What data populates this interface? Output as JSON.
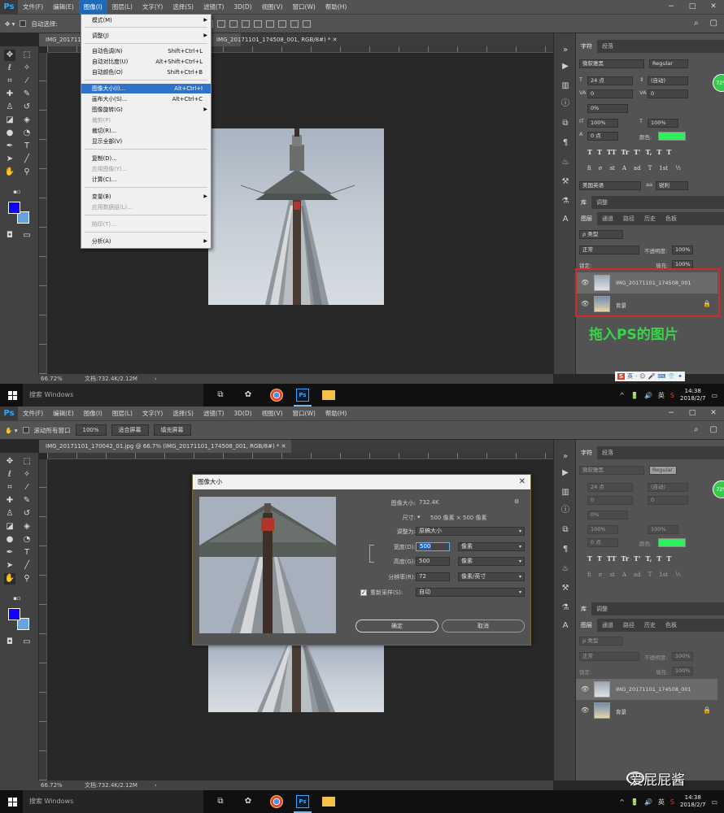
{
  "app": {
    "logo": "Ps",
    "menus": [
      "文件(F)",
      "编辑(E)",
      "图像(I)",
      "图层(L)",
      "文字(Y)",
      "选择(S)",
      "滤镜(T)",
      "3D(D)",
      "视图(V)",
      "窗口(W)",
      "帮助(H)"
    ],
    "window_controls": [
      "−",
      "□",
      "✕"
    ],
    "options_bar_1": {
      "tool_option": "自动选择:"
    },
    "options_bar_2": {
      "scroll_all": "滚动所有窗口",
      "zoom_100": "100%",
      "fit_screen": "适合屏幕",
      "fill_screen": "填充屏幕"
    },
    "tab_1": "IMG_20171101_174508_001, RGB/8#) *",
    "tab_1_prefix": "IMG_2017110",
    "tab_2": "IMG_20171101_170042_01.jpg @ 66.7% (IMG_20171101_174508_001, RGB/8#) *",
    "status": {
      "zoom": "66.72%",
      "doc": "文档:732.4K/2.12M"
    }
  },
  "image_menu": {
    "items": [
      {
        "label": "模式(M)",
        "shortcut": "",
        "arrow": true,
        "disabled": false
      },
      {
        "label": "调整(J)",
        "shortcut": "",
        "arrow": true,
        "disabled": false
      },
      {
        "label": "自动色调(N)",
        "shortcut": "Shift+Ctrl+L",
        "arrow": false,
        "disabled": false
      },
      {
        "label": "自动对比度(U)",
        "shortcut": "Alt+Shift+Ctrl+L",
        "arrow": false,
        "disabled": false
      },
      {
        "label": "自动颜色(O)",
        "shortcut": "Shift+Ctrl+B",
        "arrow": false,
        "disabled": false
      },
      {
        "label": "图像大小(I)...",
        "shortcut": "Alt+Ctrl+I",
        "arrow": false,
        "disabled": false,
        "highlight": true
      },
      {
        "label": "画布大小(S)...",
        "shortcut": "Alt+Ctrl+C",
        "arrow": false,
        "disabled": false
      },
      {
        "label": "图像旋转(G)",
        "shortcut": "",
        "arrow": true,
        "disabled": false
      },
      {
        "label": "裁剪(P)",
        "shortcut": "",
        "arrow": false,
        "disabled": true
      },
      {
        "label": "裁切(R)...",
        "shortcut": "",
        "arrow": false,
        "disabled": false
      },
      {
        "label": "显示全部(V)",
        "shortcut": "",
        "arrow": false,
        "disabled": false
      },
      {
        "label": "复制(D)...",
        "shortcut": "",
        "arrow": false,
        "disabled": false
      },
      {
        "label": "应用图像(Y)...",
        "shortcut": "",
        "arrow": false,
        "disabled": true
      },
      {
        "label": "计算(C)...",
        "shortcut": "",
        "arrow": false,
        "disabled": false
      },
      {
        "label": "变量(B)",
        "shortcut": "",
        "arrow": true,
        "disabled": false
      },
      {
        "label": "应用数据组(L)...",
        "shortcut": "",
        "arrow": false,
        "disabled": true
      },
      {
        "label": "陷印(T)...",
        "shortcut": "",
        "arrow": false,
        "disabled": true
      },
      {
        "label": "分析(A)",
        "shortcut": "",
        "arrow": true,
        "disabled": false
      }
    ]
  },
  "character_panel": {
    "tabs": [
      "字符",
      "段落"
    ],
    "font_family": "微软雅黑",
    "font_style": "Regular",
    "font_size": "24 点",
    "leading": "(自动)",
    "kerning": "0",
    "tracking": "0",
    "scale_pct": "0%",
    "vertical_scale": "100%",
    "horizontal_scale": "100%",
    "baseline": "0 点",
    "color_label": "颜色:",
    "type_styles": [
      "T",
      "T",
      "TT",
      "Tr",
      "T'",
      "T,",
      "T",
      "T"
    ],
    "opentype": [
      "fi",
      "σ",
      "st",
      "A",
      "ad",
      "T",
      "1st",
      "½"
    ],
    "language": "美国英语",
    "antialias": "锐利",
    "badge": "72%"
  },
  "layers_panel": {
    "top_tabs": [
      "库",
      "调整"
    ],
    "tabs": [
      "图层",
      "通道",
      "路径",
      "历史",
      "色板"
    ],
    "filter_kind": "ρ 类型",
    "blend_mode": "正常",
    "opacity_label": "不透明度:",
    "opacity": "100%",
    "lock_label": "锁定:",
    "fill_label": "填充:",
    "fill": "100%",
    "layers": [
      {
        "name": "IMG_20171101_174508_001",
        "selected": true
      },
      {
        "name": "背景",
        "selected": false,
        "locked": true
      }
    ]
  },
  "annotation": "拖入PS的图片",
  "image_size_dialog": {
    "title": "图像大小",
    "close": "✕",
    "image_size_label": "图像大小:",
    "image_size_value": "732.4K",
    "dimensions_label": "尺寸:",
    "dimensions_value": "500 像素 × 500 像素",
    "fit_to_label": "调整为:",
    "fit_to_value": "原稿大小",
    "width_label": "宽度(D):",
    "width_value": "500",
    "width_unit": "像素",
    "height_label": "高度(G):",
    "height_value": "500",
    "height_unit": "像素",
    "resolution_label": "分辨率(R):",
    "resolution_value": "72",
    "resolution_unit": "像素/英寸",
    "resample_label": "重新采样(S):",
    "resample_value": "自动",
    "ok": "确定",
    "cancel": "取消"
  },
  "taskbar": {
    "search": "搜索 Windows",
    "time": "14:38",
    "date": "2018/2/7",
    "ime_lang": "英",
    "tray": [
      "^",
      "🔋",
      "🔊",
      "英",
      "S"
    ]
  },
  "ime_toolbar": {
    "logo": "S",
    "lang": "英",
    "items": [
      "·",
      "☺",
      "🎤",
      "⌨",
      "👕",
      "✦"
    ]
  },
  "watermark": {
    "text": "爱屁屁酱"
  },
  "colors": {
    "ps_blue": "#31a8ff",
    "menu_highlight": "#2f72c9",
    "red_frame": "#d22a2a",
    "annotation_green": "#39d44a",
    "foreground": "#1100ff",
    "background": "#66a3de",
    "text_color_chip": "#2bf25b"
  },
  "icons": [
    "move-icon",
    "marquee-icon",
    "lasso-icon",
    "magic-wand-icon",
    "crop-icon",
    "eyedropper-icon",
    "healing-brush-icon",
    "brush-icon",
    "stamp-icon",
    "history-brush-icon",
    "eraser-icon",
    "bucket-icon",
    "blur-icon",
    "dodge-icon",
    "pen-icon",
    "type-icon",
    "path-select-icon",
    "shape-icon",
    "hand-icon",
    "zoom-icon",
    "quick-mask-icon",
    "screen-mode-icon"
  ]
}
